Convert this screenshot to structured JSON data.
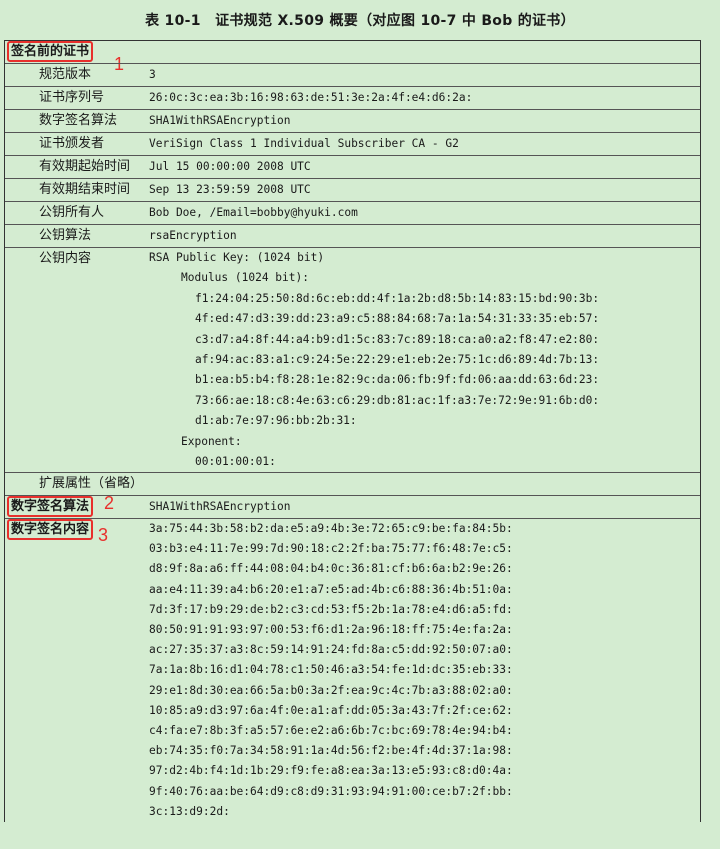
{
  "caption": "表 10-1　证书规范 X.509 概要（对应图 10-7 中 Bob 的证书）",
  "section_before_sig": "签名前的证书",
  "marks": {
    "m1": "1",
    "m2": "2",
    "m3": "3"
  },
  "fields": [
    {
      "label": "规范版本",
      "value": "3"
    },
    {
      "label": "证书序列号",
      "value": "26:0c:3c:ea:3b:16:98:63:de:51:3e:2a:4f:e4:d6:2a:"
    },
    {
      "label": "数字签名算法",
      "value": "SHA1WithRSAEncryption"
    },
    {
      "label": "证书颁发者",
      "value": "VeriSign Class 1 Individual Subscriber CA - G2"
    },
    {
      "label": "有效期起始时间",
      "value": "Jul 15 00:00:00 2008 UTC"
    },
    {
      "label": "有效期结束时间",
      "value": "Sep 13 23:59:59 2008 UTC"
    },
    {
      "label": "公钥所有人",
      "value": "Bob Doe, /Email=bobby@hyuki.com"
    },
    {
      "label": "公钥算法",
      "value": "rsaEncryption"
    }
  ],
  "public_key": {
    "label": "公钥内容",
    "title": "RSA Public Key: (1024 bit)",
    "modulus_label": "Modulus (1024 bit):",
    "modulus_lines": [
      "f1:24:04:25:50:8d:6c:eb:dd:4f:1a:2b:d8:5b:14:83:15:bd:90:3b:",
      "4f:ed:47:d3:39:dd:23:a9:c5:88:84:68:7a:1a:54:31:33:35:eb:57:",
      "c3:d7:a4:8f:44:a4:b9:d1:5c:83:7c:89:18:ca:a0:a2:f8:47:e2:80:",
      "af:94:ac:83:a1:c9:24:5e:22:29:e1:eb:2e:75:1c:d6:89:4d:7b:13:",
      "b1:ea:b5:b4:f8:28:1e:82:9c:da:06:fb:9f:fd:06:aa:dd:63:6d:23:",
      "73:66:ae:18:c8:4e:63:c6:29:db:81:ac:1f:a3:7e:72:9e:91:6b:d0:",
      "d1:ab:7e:97:96:bb:2b:31:"
    ],
    "exponent_label": "Exponent:",
    "exponent_value": "00:01:00:01:"
  },
  "extensions": "扩展属性（省略）",
  "sig_algo": {
    "label": "数字签名算法",
    "value": "SHA1WithRSAEncryption"
  },
  "sig_content": {
    "label": "数字签名内容",
    "lines": [
      "3a:75:44:3b:58:b2:da:e5:a9:4b:3e:72:65:c9:be:fa:84:5b:",
      "03:b3:e4:11:7e:99:7d:90:18:c2:2f:ba:75:77:f6:48:7e:c5:",
      "d8:9f:8a:a6:ff:44:08:04:b4:0c:36:81:cf:b6:6a:b2:9e:26:",
      "aa:e4:11:39:a4:b6:20:e1:a7:e5:ad:4b:c6:88:36:4b:51:0a:",
      "7d:3f:17:b9:29:de:b2:c3:cd:53:f5:2b:1a:78:e4:d6:a5:fd:",
      "80:50:91:91:93:97:00:53:f6:d1:2a:96:18:ff:75:4e:fa:2a:",
      "ac:27:35:37:a3:8c:59:14:91:24:fd:8a:c5:dd:92:50:07:a0:",
      "7a:1a:8b:16:d1:04:78:c1:50:46:a3:54:fe:1d:dc:35:eb:33:",
      "29:e1:8d:30:ea:66:5a:b0:3a:2f:ea:9c:4c:7b:a3:88:02:a0:",
      "10:85:a9:d3:97:6a:4f:0e:a1:af:dd:05:3a:43:7f:2f:ce:62:",
      "c4:fa:e7:8b:3f:a5:57:6e:e2:a6:6b:7c:bc:69:78:4e:94:b4:",
      "eb:74:35:f0:7a:34:58:91:1a:4d:56:f2:be:4f:4d:37:1a:98:",
      "97:d2:4b:f4:1d:1b:29:f9:fe:a8:ea:3a:13:e5:93:c8:d0:4a:",
      "9f:40:76:aa:be:64:d9:c8:d9:31:93:94:91:00:ce:b7:2f:bb:",
      "3c:13:d9:2d:"
    ]
  }
}
